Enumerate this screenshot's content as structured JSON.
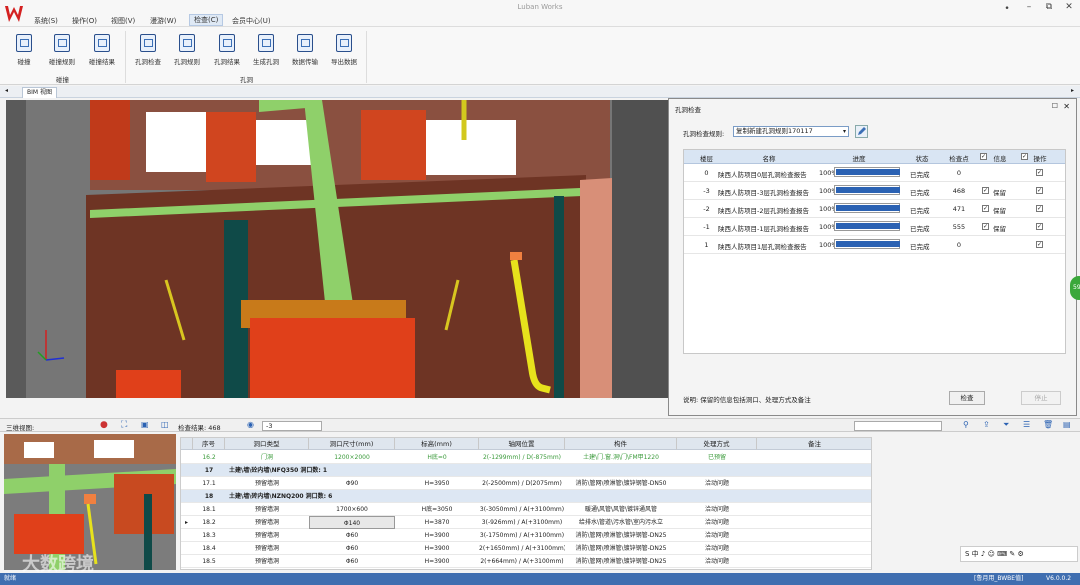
{
  "app": {
    "title": "Luban Works"
  },
  "menu": [
    "系统(S)",
    "操作(O)",
    "视图(V)",
    "漫游(W)",
    "检查(C)",
    "会员中心(U)"
  ],
  "window_controls": [
    "•",
    "–",
    "⧉",
    "✕"
  ],
  "ribbon": {
    "buttons": [
      "碰撞",
      "碰撞规则",
      "碰撞结果",
      "孔洞检查",
      "孔洞规则",
      "孔洞结果",
      "生成孔洞",
      "数据传输",
      "导出数据"
    ],
    "groups": [
      "碰撞",
      "孔洞"
    ]
  },
  "tab": {
    "label": "BIM 视图"
  },
  "dialog": {
    "title": "孔洞检查",
    "rule_label": "孔洞检查规则:",
    "rule_value": "复制新建孔洞规则170117",
    "headers": [
      "楼层",
      "名称",
      "进度",
      "状态",
      "检查点",
      "信息",
      "操作"
    ],
    "rows": [
      {
        "floor": "0",
        "name": "陕西人防项目0层孔洞检查报告",
        "progress": 1.0,
        "progress_text": "100%",
        "status": "已完成",
        "points": "0",
        "info_checked": false,
        "info": "",
        "op_checked": true
      },
      {
        "floor": "-3",
        "name": "陕西人防项目-3层孔洞检查报告",
        "progress": 1.0,
        "progress_text": "100%",
        "status": "已完成",
        "points": "468",
        "info_checked": true,
        "info": "保留",
        "op_checked": true
      },
      {
        "floor": "-2",
        "name": "陕西人防项目-2层孔洞检查报告",
        "progress": 1.0,
        "progress_text": "100%",
        "status": "已完成",
        "points": "471",
        "info_checked": true,
        "info": "保留",
        "op_checked": true
      },
      {
        "floor": "-1",
        "name": "陕西人防项目-1层孔洞检查报告",
        "progress": 1.0,
        "progress_text": "100%",
        "status": "已完成",
        "points": "555",
        "info_checked": true,
        "info": "保留",
        "op_checked": true
      },
      {
        "floor": "1",
        "name": "陕西人防项目1层孔洞检查报告",
        "progress": 1.0,
        "progress_text": "100%",
        "status": "已完成",
        "points": "0",
        "info_checked": false,
        "info": "",
        "op_checked": true
      }
    ],
    "note": "说明: 保留的信息包括洞口、处理方式及备注",
    "check_button": "检查",
    "stop_button": "停止"
  },
  "bottom_toolbar": {
    "view_label": "三维视图:",
    "result_label": "检查结果: 468",
    "floor_value": "-3"
  },
  "table": {
    "headers": [
      "序号",
      "洞口类型",
      "洞口尺寸(mm)",
      "标高(mm)",
      "轴网位置",
      "构件",
      "处理方式",
      "备注"
    ],
    "rows": [
      {
        "kind": "data",
        "no": "16.2",
        "type": "门洞",
        "size": "1200×2000",
        "elev": "H底=0",
        "axis": "2(-1299mm) / D(-875mm)",
        "comp": "土建\\门.窗.洞\\门\\FM甲1220",
        "action": "已预留",
        "note": "",
        "green": true
      },
      {
        "kind": "group",
        "no": "17",
        "text": "土建\\墙\\砼内墙\\NFQ350 洞口数: 1"
      },
      {
        "kind": "data",
        "no": "17.1",
        "type": "预留墙洞",
        "size": "Φ90",
        "elev": "H=3950",
        "axis": "2(-2500mm) / D(2075mm)",
        "comp": "消防\\管网\\喷淋管\\镀锌钢管-DN50",
        "action": "洽动问题",
        "note": ""
      },
      {
        "kind": "group",
        "no": "18",
        "text": "土建\\墙\\砖内墙\\NZNQ200 洞口数: 6"
      },
      {
        "kind": "data",
        "no": "18.1",
        "type": "预留墙洞",
        "size": "1700×600",
        "elev": "H底=3050",
        "axis": "3(-3050mm) / A(+3100mm)",
        "comp": "暖通\\风管\\风管\\镀锌通风管",
        "action": "洽动问题",
        "note": ""
      },
      {
        "kind": "data",
        "no": "18.2",
        "type": "预留墙洞",
        "size": "Φ140",
        "elev": "H=3870",
        "axis": "3(-926mm) / A(+3100mm)",
        "comp": "给排水\\管道\\污水管\\室内污水立",
        "action": "洽动问题",
        "note": "",
        "selected": true
      },
      {
        "kind": "data",
        "no": "18.3",
        "type": "预留墙洞",
        "size": "Φ60",
        "elev": "H=3900",
        "axis": "3(-1750mm) / A(+3100mm)",
        "comp": "消防\\管网\\喷淋管\\镀锌钢管-DN25",
        "action": "洽动问题",
        "note": ""
      },
      {
        "kind": "data",
        "no": "18.4",
        "type": "预留墙洞",
        "size": "Φ60",
        "elev": "H=3900",
        "axis": "2(+1650mm) / A(+3100mm)",
        "comp": "消防\\管网\\喷淋管\\镀锌钢管-DN25",
        "action": "洽动问题",
        "note": ""
      },
      {
        "kind": "data",
        "no": "18.5",
        "type": "预留墙洞",
        "size": "Φ60",
        "elev": "H=3900",
        "axis": "2(+664mm) / A(+3100mm)",
        "comp": "消防\\管网\\喷淋管\\镀锌钢管-DN25",
        "action": "洽动问题",
        "note": ""
      }
    ]
  },
  "status": {
    "left": "就绪",
    "right_user": "[鲁月用_BWBE值]",
    "version": "V6.0.0.2"
  },
  "badge": "59",
  "ime": "S 中 ♪ ☺ ⌨ ✎ ⚙",
  "watermark": "大数跨境",
  "colors": {
    "accent": "#2b62b3",
    "logo": "#d42020",
    "status": "#3f6eb0"
  }
}
